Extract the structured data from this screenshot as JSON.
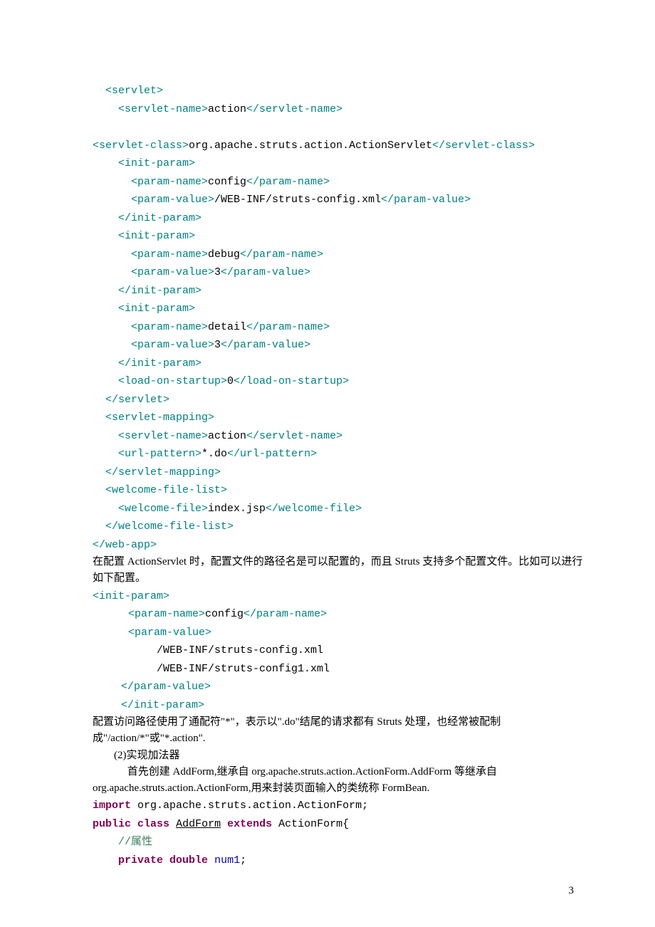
{
  "c1o": "  <servlet>",
  "c2a": "    <servlet-name>",
  "c2t": "action",
  "c2b": "</servlet-name>",
  "c3a": "<servlet-class>",
  "c3t": "org.apache.struts.action.ActionServlet",
  "c3b": "</servlet-class>",
  "c4": "    <init-param>",
  "c5a": "      <param-name>",
  "c5t": "config",
  "c5b": "</param-name>",
  "c6a": "      <param-value>",
  "c6t": "/WEB-INF/struts-config.xml",
  "c6b": "</param-value>",
  "c7": "    </init-param>",
  "c8": "    <init-param>",
  "c9a": "      <param-name>",
  "c9t": "debug",
  "c9b": "</param-name>",
  "c10a": "      <param-value>",
  "c10t": "3",
  "c10b": "</param-value>",
  "c11": "    </init-param>",
  "c12": "    <init-param>",
  "c13a": "      <param-name>",
  "c13t": "detail",
  "c13b": "</param-name>",
  "c14a": "      <param-value>",
  "c14t": "3",
  "c14b": "</param-value>",
  "c15": "    </init-param>",
  "c16a": "    <load-on-startup>",
  "c16t": "0",
  "c16b": "</load-on-startup>",
  "c17": "  </servlet>",
  "c18": "  <servlet-mapping>",
  "c19a": "    <servlet-name>",
  "c19t": "action",
  "c19b": "</servlet-name>",
  "c20a": "    <url-pattern>",
  "c20t": "*.do",
  "c20b": "</url-pattern>",
  "c21": "  </servlet-mapping>",
  "c22": "  <welcome-file-list>",
  "c23a": "    <welcome-file>",
  "c23t": "index.jsp",
  "c23b": "</welcome-file>",
  "c24": "  </welcome-file-list>",
  "c25": "</web-app>",
  "p1": "在配置 ActionServlet 时，配置文件的路径名是可以配置的，而且 Struts 支持多个配置文件。比如可以进行如下配置。",
  "d1": "<init-param>",
  "d2a": "<param-name>",
  "d2t": "config",
  "d2b": "</param-name>",
  "d3": "<param-value>",
  "d4": "/WEB-INF/struts-config.xml",
  "d5": "/WEB-INF/struts-config1.xml",
  "d6": "</param-value>",
  "d7": "</init-param>",
  "p2": "配置访问路径使用了通配符\"*\"，表示以\".do\"结尾的请求都有 Struts 处理，也经常被配制成\"/action/*\"或\"*.action\".",
  "p3": "        (2)实现加法器",
  "p4": "             首先创建 AddForm,继承自 org.apache.struts.action.ActionForm.AddForm 等继承自org.apache.struts.action.ActionForm,用来封装页面输入的类统称 FormBean.",
  "j1a": "import",
  "j1b": " org.apache.struts.action.ActionForm;",
  "j2a": "public",
  "j2b": " ",
  "j2c": "class",
  "j2d": " ",
  "j2e": "AddForm",
  "j2f": " ",
  "j2g": "extends",
  "j2h": " ActionForm{",
  "j3": "    //属性",
  "j4a": "    ",
  "j4b": "private",
  "j4c": " ",
  "j4d": "double",
  "j4e": " ",
  "j4f": "num1",
  "j4g": ";",
  "pageno": "3"
}
